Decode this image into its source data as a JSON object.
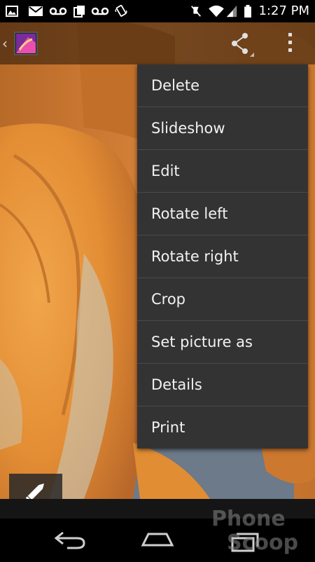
{
  "status_bar": {
    "time": "1:27 PM",
    "left_icons": [
      "image-notification-icon",
      "gmail-icon",
      "voicemail-icon",
      "copy-notification-icon",
      "voicemail-icon",
      "vibrate-icon"
    ],
    "right_icons": [
      "mute-icon",
      "wifi-icon",
      "signal-icon",
      "battery-icon"
    ]
  },
  "action_bar": {
    "back_glyph": "‹",
    "app_icon": "gallery-app-icon",
    "share_icon": "share-icon",
    "overflow_icon": "overflow-menu-icon"
  },
  "menu": {
    "items": [
      {
        "label": "Delete"
      },
      {
        "label": "Slideshow"
      },
      {
        "label": "Edit"
      },
      {
        "label": "Rotate left"
      },
      {
        "label": "Rotate right"
      },
      {
        "label": "Crop"
      },
      {
        "label": "Set picture as"
      },
      {
        "label": "Details"
      },
      {
        "label": "Print"
      }
    ]
  },
  "edit_button": {
    "icon": "pencil-icon"
  },
  "nav_bar": {
    "icons": [
      "back-icon",
      "home-icon",
      "recent-apps-icon"
    ]
  },
  "watermark": {
    "brand": "Phone Scoop"
  },
  "colors": {
    "menu_bg": "#333333",
    "menu_divider": "#4a4a4a",
    "pumpkin": "#e08a2a"
  }
}
